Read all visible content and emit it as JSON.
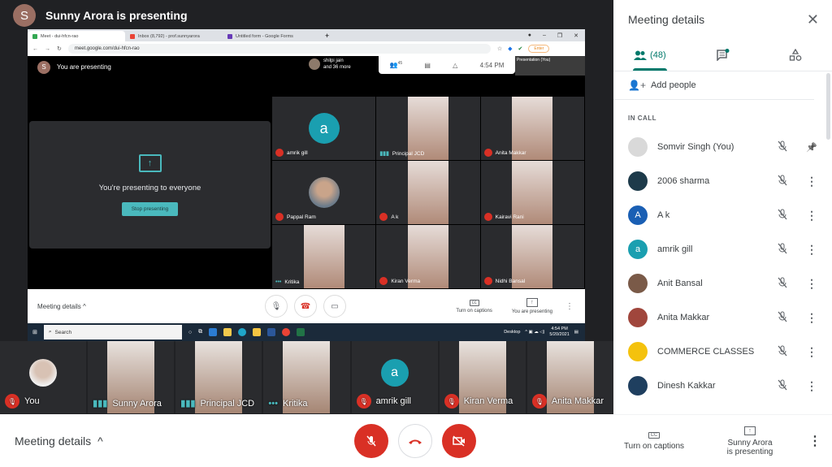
{
  "header": {
    "presenter_initial": "S",
    "title": "Sunny Arora is presenting"
  },
  "shared_screen": {
    "browser": {
      "tabs": [
        {
          "label": "Meet - dui-hfcn-rao",
          "active": true,
          "favicon_color": "#34a853"
        },
        {
          "label": "Inbox (8,792) - prof.sunnyarora",
          "active": false,
          "favicon_color": "#ea4335"
        },
        {
          "label": "Untitled form - Google Forms",
          "active": false,
          "favicon_color": "#673ab7"
        }
      ],
      "new_tab": "+",
      "url": "meet.google.com/dui-hfcn-rao",
      "enter_label": "Enter"
    },
    "meet_top": {
      "initial": "S",
      "you_are_presenting": "You are presenting",
      "others_line1": "shilpi jain",
      "others_line2": "and 36 more",
      "people_count": "45",
      "time": "4:54 PM",
      "presentation_label": "Presentation (You)",
      "you_label": "You"
    },
    "presenting_card": {
      "message": "You're presenting to everyone",
      "stop_button": "Stop presenting"
    },
    "grid": [
      {
        "name": "amrik gill",
        "type": "avatar",
        "initial": "a",
        "status": "muted"
      },
      {
        "name": "Principal JCD",
        "type": "video",
        "status": "speaking"
      },
      {
        "name": "Anita Makkar",
        "type": "video",
        "status": "muted"
      },
      {
        "name": "Pappal Ram",
        "type": "photo",
        "status": "muted"
      },
      {
        "name": "A k",
        "type": "video",
        "status": "muted"
      },
      {
        "name": "Kairavi Rani",
        "type": "video",
        "status": "muted"
      },
      {
        "name": "Kritika",
        "type": "video",
        "status": "active"
      },
      {
        "name": "Kiran Verma",
        "type": "video",
        "status": "muted"
      },
      {
        "name": "Nidhi Bansal",
        "type": "video",
        "status": "muted"
      }
    ],
    "bottom": {
      "meeting_details": "Meeting details",
      "captions": "Turn on captions",
      "presenting": "You are presenting"
    },
    "taskbar": {
      "search": "Search",
      "desktop": "Desktop",
      "time": "4:54 PM",
      "date": "5/20/2021"
    }
  },
  "filmstrip": [
    {
      "name": "You",
      "type": "photo",
      "status": "muted"
    },
    {
      "name": "Sunny Arora",
      "type": "video",
      "status": "speaking"
    },
    {
      "name": "Principal JCD",
      "type": "video",
      "status": "speaking"
    },
    {
      "name": "Kritika",
      "type": "video",
      "status": "active"
    },
    {
      "name": "amrik gill",
      "type": "avatar",
      "initial": "a",
      "status": "muted"
    },
    {
      "name": "Kiran Verma",
      "type": "video",
      "status": "muted"
    },
    {
      "name": "Anita Makkar",
      "type": "video",
      "status": "muted"
    }
  ],
  "bottombar": {
    "meeting_details": "Meeting details",
    "chevron": "^"
  },
  "sidebar": {
    "title": "Meeting details",
    "tabs": [
      {
        "id": "people",
        "label": "(48)",
        "active": true
      },
      {
        "id": "chat",
        "label": "",
        "active": false
      },
      {
        "id": "activities",
        "label": "",
        "active": false
      }
    ],
    "add_people": "Add people",
    "section": "IN CALL",
    "participants": [
      {
        "name": "Somvir Singh (You)",
        "avatar": "",
        "color": "#d9d9d9",
        "action": "pin"
      },
      {
        "name": "2006 sharma",
        "avatar": "",
        "color": "#1d3a4a",
        "action": "more"
      },
      {
        "name": "A k",
        "avatar": "A",
        "color": "#1a5fb4",
        "action": "more"
      },
      {
        "name": "amrik gill",
        "avatar": "a",
        "color": "#1a9fb0",
        "action": "more"
      },
      {
        "name": "Anit Bansal",
        "avatar": "",
        "color": "#7a5a48",
        "action": "more"
      },
      {
        "name": "Anita Makkar",
        "avatar": "",
        "color": "#a0463c",
        "action": "more"
      },
      {
        "name": "COMMERCE CLASSES",
        "avatar": "",
        "color": "#f4c20d",
        "action": "more"
      },
      {
        "name": "Dinesh Kakkar",
        "avatar": "",
        "color": "#1f3f5f",
        "action": "more"
      }
    ],
    "captions": "Turn on captions",
    "presenting_line1": "Sunny Arora",
    "presenting_line2": "is presenting"
  },
  "colors": {
    "accent": "#00796b",
    "danger": "#d93025",
    "teal": "#4ab9bd",
    "dark_bg": "#202124"
  }
}
